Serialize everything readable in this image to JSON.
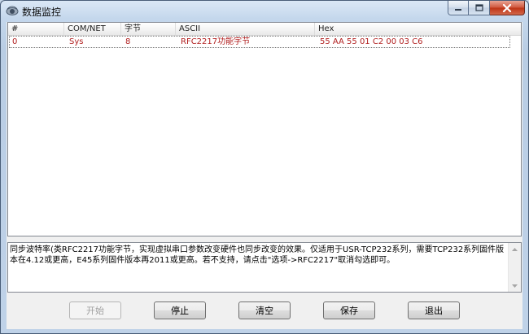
{
  "window": {
    "title": "数据监控",
    "title_icon": "monitor-eye-icon"
  },
  "caption_buttons": {
    "minimize_icon": "minimize-icon",
    "maximize_icon": "maximize-icon",
    "close_icon": "close-icon"
  },
  "list": {
    "columns": [
      "#",
      "COM/NET",
      "字节",
      "ASCII",
      "Hex"
    ],
    "rows": [
      {
        "index": "0",
        "source": "Sys",
        "bytes": "8",
        "ascii": "RFC2217功能字节",
        "hex": "55 AA 55 01 C2 00 03 C6"
      }
    ],
    "row_text_color": "#b01e1e"
  },
  "info": {
    "text": "同步波特率(类RFC2217功能字节，实现虚拟串口参数改变硬件也同步改变的效果。仅适用于USR-TCP232系列，需要TCP232系列固件版本在4.12或更高，E45系列固件版本再2011或更高。若不支持，请点击\"选项->RFC2217\"取消勾选即可。"
  },
  "buttons": {
    "start": "开始",
    "stop": "停止",
    "clear": "清空",
    "save": "保存",
    "exit": "退出"
  },
  "colors": {
    "close_button": "#c7401f",
    "window_frame": "#c4d7ec"
  }
}
